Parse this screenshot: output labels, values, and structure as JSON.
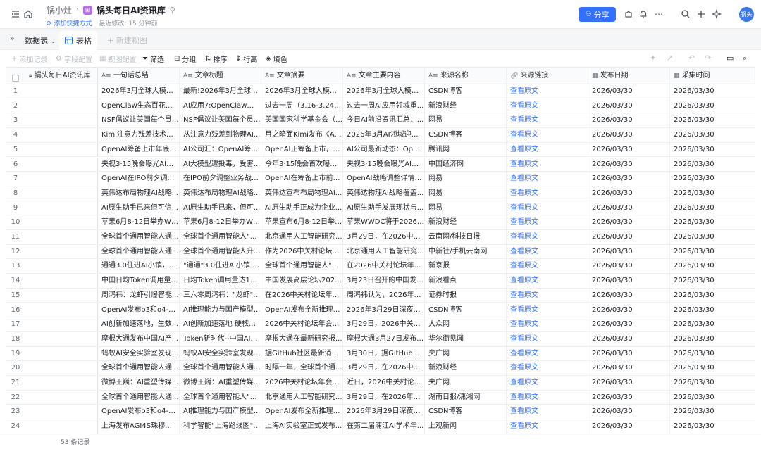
{
  "header": {
    "workspace": "锅小灶",
    "base_title": "锅头每日AI资讯库",
    "quick_link": "添加快捷方式",
    "modified": "最近修改: 15 分钟前",
    "share_label": "分享",
    "avatar_text": "锅头"
  },
  "viewbar": {
    "data_table_label": "数据表",
    "active_tab_label": "表格",
    "new_view_label": "新建视图"
  },
  "toolbar": {
    "add_record": "添加记录",
    "field_config": "字段配置",
    "view_config": "视图配置",
    "filter": "筛选",
    "group": "分组",
    "sort": "排序",
    "row_height": "行高",
    "fill_color": "填色"
  },
  "columns": [
    "锅头每日AI资讯库",
    "一句话总结",
    "文章标题",
    "文章摘要",
    "文章主要内容",
    "来源名称",
    "来源链接",
    "发布日期",
    "采集时间"
  ],
  "rows": [
    [
      "",
      "2026年3月全球大模型...",
      "最新!2026年3月全球大...",
      "2026年3月全球大模型领...",
      "2026年3月全球大模型领...",
      "CSDN博客",
      "查看原文",
      "2026/03/30",
      "2026/03/30"
    ],
    [
      "",
      "OpenClaw生态百花齐放...",
      "AI应用7:OpenClaw冷了...",
      "过去一周（3.16-3.24）...",
      "过去一周AI应用领域重...",
      "新浪财经",
      "查看原文",
      "2026/03/30",
      "2026/03/30"
    ],
    [
      "",
      "NSF倡议让美国每个员工...",
      "NSF倡议让美国每个员工...",
      "美国国家科学基金会（N...",
      "今日AI前沿资讯汇总：...",
      "网易",
      "查看原文",
      "2026/03/30",
      "2026/03/30"
    ],
    [
      "",
      "Kimi注意力残差技术实...",
      "从注意力残差到物理AI...",
      "月之暗面Kimi发布《Atte...",
      "2026年3月AI领域迎来双...",
      "CSDN博客",
      "查看原文",
      "2026/03/30",
      "2026/03/30"
    ],
    [
      "",
      "OpenAI筹备上市年底前...",
      "AI公司汇：OpenAI筹备I...",
      "OpenAI正筹备上市，可...",
      "AI公司最新动态：Open...",
      "腾讯网",
      "查看原文",
      "2026/03/30",
      "2026/03/30"
    ],
    [
      "",
      "央视3·15晚会曝光AI大...",
      "AI大模型遭投毒，受害...",
      "今年3·15晚会首次曝光AI...",
      "央视3·15晚会曝光AI大...",
      "中国经济网",
      "查看原文",
      "2026/03/30",
      "2026/03/30"
    ],
    [
      "",
      "OpenAI在IPO前夕调整...",
      "在IPO前夕调整业务战略...",
      "OpenAI在筹备上市前进...",
      "OpenAI战略调整详情：...",
      "网易",
      "查看原文",
      "2026/03/30",
      "2026/03/30"
    ],
    [
      "",
      "英伟达布局物理AI战略...",
      "英伟达布局物理AI战略...",
      "英伟达宣布布局物理AI...",
      "英伟达物理AI战略覆盖...",
      "网易",
      "查看原文",
      "2026/03/30",
      "2026/03/30"
    ],
    [
      "",
      "AI原生助手已来但可信...",
      "AI原生助手已来，但可...",
      "AI原生助手正成为企业...",
      "AI原生助手发展现状与...",
      "网易",
      "查看原文",
      "2026/03/30",
      "2026/03/30"
    ],
    [
      "",
      "苹果6月8-12日举办WW...",
      "苹果6月8-12日举办WW...",
      "苹果宣布6月8-12日举办...",
      "苹果WWDC将于2026年...",
      "新浪财经",
      "查看原文",
      "2026/03/30",
      "2026/03/30"
    ],
    [
      "",
      "全球首个通用智能人通...",
      "全球首个通用智能人\"通...",
      "北京通用人工智能研究...",
      "3月29日，在2026中关...",
      "云南网/科技日报",
      "查看原文",
      "2026/03/30",
      "2026/03/30"
    ],
    [
      "",
      "全球首个通用智能人通...",
      "全球首个通用智能人升...",
      "作为2026中关村论坛年...",
      "北京通用人工智能研究...",
      "中新社/手机云南网",
      "查看原文",
      "2026/03/30",
      "2026/03/30"
    ],
    [
      "",
      "通通3.0住进AI小镇，在...",
      "\"通通\"3.0住进AI小镇 在...",
      "全球首个通用智能人\"通...",
      "在2026中关村论坛年会...",
      "新京报",
      "查看原文",
      "2026/03/30",
      "2026/03/30"
    ],
    [
      "",
      "中国日均Token调用量突...",
      "日均Token调用量达140...",
      "中国发展高层论坛2026...",
      "3月23日召开的中国发展...",
      "新浪看点",
      "查看原文",
      "2026/03/30",
      "2026/03/30"
    ],
    [
      "",
      "周鸿祎：龙虾引爆智能...",
      "三六零周鸿祎：\"龙虾\"引...",
      "在2026中关村论坛年会...",
      "周鸿祎认为，2026年\"龙...",
      "证券时报",
      "查看原文",
      "2026/03/30",
      "2026/03/30"
    ],
    [
      "",
      "OpenAI发布o3和o4-mini...",
      "AI推理能力与国产模型...",
      "OpenAI发布全新推理模...",
      "2026年3月29日深夜，O...",
      "CSDN博客",
      "查看原文",
      "2026/03/30",
      "2026/03/30"
    ],
    [
      "",
      "AI创新加速落地，生数...",
      "AI创新加速落地 硬核成...",
      "2026中关村论坛年会AI...",
      "3月29日，2026中关村...",
      "大众网",
      "查看原文",
      "2026/03/30",
      "2026/03/30"
    ],
    [
      "",
      "摩根大通发布中国AI产...",
      "Token新时代--中国AI产...",
      "摩根大通在最新研究报...",
      "摩根大通3月27日发布的...",
      "华尔街见闻",
      "查看原文",
      "2026/03/30",
      "2026/03/30"
    ],
    [
      "",
      "蚂蚁AI安全实验室发现O...",
      "蚂蚁AI安全实验室发现O...",
      "据GitHub社区最新消息...",
      "3月30日，据GitHub社区...",
      "央广网",
      "查看原文",
      "2026/03/30",
      "2026/03/30"
    ],
    [
      "",
      "全球首个通用智能人通...",
      "全球首个通用智能人通...",
      "时隔一年，全球首个通...",
      "3月29日，在2026中关...",
      "新浪财经",
      "查看原文",
      "2026/03/30",
      "2026/03/30"
    ],
    [
      "",
      "微博王巍：AI重塑传媒...",
      "微博王巍：AI重塑传媒...",
      "2026中关村论坛年会人...",
      "近日，2026中关村论坛...",
      "央广网",
      "查看原文",
      "2026/03/30",
      "2026/03/30"
    ],
    [
      "",
      "全球首个通用智能人通...",
      "全球首个通用智能人\"通...",
      "北京通用人工智能研究...",
      "3月29日，在2026年中...",
      "湖南日报/潇湘网",
      "查看原文",
      "2026/03/30",
      "2026/03/30"
    ],
    [
      "",
      "OpenAI发布o3和o4-mini...",
      "AI推理能力与国产模型...",
      "OpenAI发布全新推理模...",
      "2026年3月29日深夜，O...",
      "CSDN博客",
      "查看原文",
      "2026/03/30",
      "2026/03/30"
    ],
    [
      "",
      "上海发布AGI4S珠穆朗玛...",
      "科学智能\"上海路线图\"亮...",
      "上海AI实验室正式发布...",
      "在第二届浦江AI学术年...",
      "上观新闻",
      "查看原文",
      "2026/03/30",
      "2026/03/30"
    ]
  ],
  "footer": {
    "record_count": "53 条记录"
  }
}
